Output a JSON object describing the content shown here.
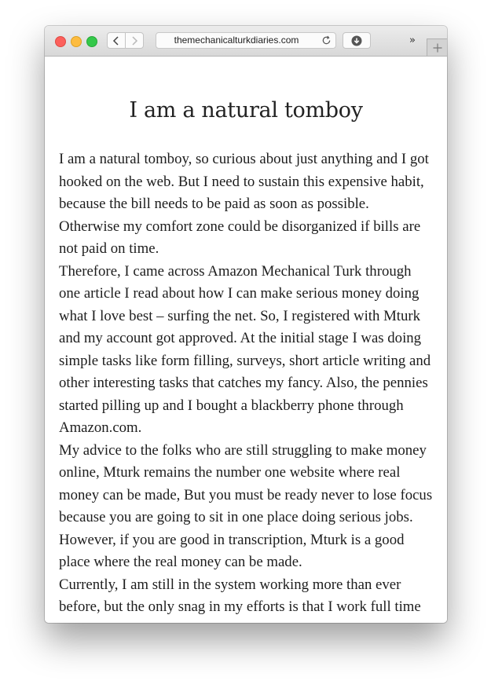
{
  "browser": {
    "url": "themechanicalturkdiaries.com",
    "overflow_label": "»",
    "new_tab_label": "+"
  },
  "article": {
    "title": "I am a natural tomboy",
    "paragraphs": [
      "I am a natural tomboy, so curious about just anything and I got hooked on the web. But I need to sustain this expensive habit, because the bill needs to be paid as soon as possible. Otherwise my comfort zone could be disorganized if bills are not paid on time.",
      "Therefore, I came across Amazon Mechanical Turk through one article I read about how I can make serious money doing what I love best – surfing the net. So, I registered with Mturk and my account got approved. At the initial stage I was doing simple tasks like form filling, surveys, short article writing and other interesting tasks that catches my fancy. Also, the pennies started pilling up and I bought a blackberry phone through Amazon.com.",
      "My advice to the folks who are still struggling to make money online, Mturk remains the number one website where real money can be made, But you must be ready never to lose focus because you are going to sit in one place doing serious jobs. However, if you are good in transcription, Mturk is a good place where the real money can be made.",
      "Currently, I am still in the system working more than ever before, but the only snag in my efforts is that I work full time with a very serious company that could get me fired if"
    ]
  }
}
